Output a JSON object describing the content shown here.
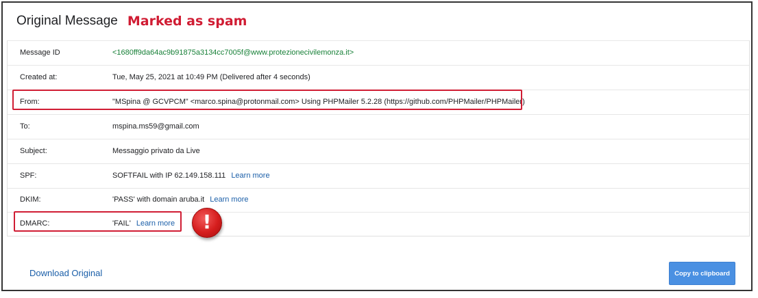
{
  "header": {
    "title": "Original Message",
    "spam_label": "Marked as spam"
  },
  "rows": [
    {
      "label": "Message ID",
      "value": "<1680ff9da64ac9b91875a3134cc7005f@www.protezionecivilemonza.it>"
    },
    {
      "label": "Created at:",
      "value": "Tue, May 25, 2021 at 10:49 PM (Delivered after 4 seconds)"
    },
    {
      "label": "From:",
      "value": "\"MSpina @ GCVPCM\" <marco.spina@protonmail.com> Using PHPMailer 5.2.28 (https://github.com/PHPMailer/PHPMailer)"
    },
    {
      "label": "To:",
      "value": "mspina.ms59@gmail.com"
    },
    {
      "label": "Subject:",
      "value": "Messaggio privato da Live"
    },
    {
      "label": "SPF:",
      "value": "SOFTFAIL with IP 62.149.158.111",
      "link": "Learn more"
    },
    {
      "label": "DKIM:",
      "value": "'PASS' with domain aruba.it",
      "link": "Learn more"
    },
    {
      "label": "DMARC:",
      "value": "'FAIL'",
      "link": "Learn more"
    }
  ],
  "alert_icon": {
    "icon": "exclamation-icon",
    "glyph": "!",
    "color": "#d51d1d"
  },
  "footer": {
    "download_label": "Download Original",
    "copy_label": "Copy to clipboard"
  },
  "colors": {
    "accent": "#d01c33",
    "link": "#1a5ea8",
    "message_id": "#188038",
    "button": "#4a90e2"
  }
}
